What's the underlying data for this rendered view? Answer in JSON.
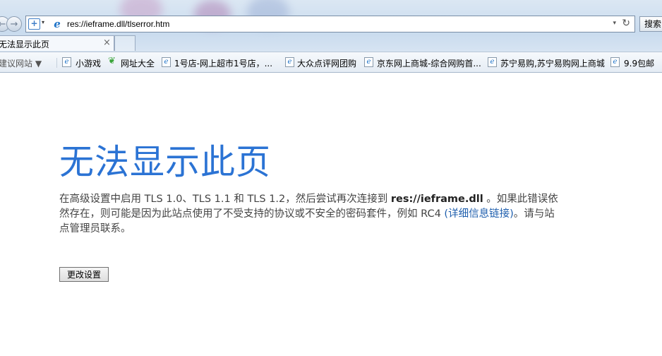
{
  "browser": {
    "address_url": "res://ieframe.dll/tlserror.htm",
    "search_label": "搜索",
    "tab_title": "无法显示此页",
    "tab_close": "×",
    "refresh_glyph": "↻",
    "chevron_glyph": "▾"
  },
  "favorites_bar": {
    "items": [
      {
        "label": "建议网站 ▼",
        "icon": "suggested-sites-icon"
      },
      {
        "label": "小游戏",
        "icon": "ie-page-icon"
      },
      {
        "label": "网址大全",
        "icon": "green-leaf-icon"
      },
      {
        "label": "1号店-网上超市1号店，...",
        "icon": "ie-page-icon"
      },
      {
        "label": "大众点评网团购",
        "icon": "ie-page-icon"
      },
      {
        "label": "京东网上商城-综合网购首...",
        "icon": "ie-page-icon"
      },
      {
        "label": "苏宁易购,苏宁易购网上商城",
        "icon": "ie-page-icon"
      },
      {
        "label": "9.9包邮",
        "icon": "ie-page-icon"
      }
    ]
  },
  "error_page": {
    "title": "无法显示此页",
    "body_part1": "在高级设置中启用 TLS 1.0、TLS 1.1 和 TLS 1.2，然后尝试再次连接到 ",
    "body_bold_url": "res://ieframe.dll",
    "body_part2": " 。如果此错误依然存在，则可能是因为此站点使用了不受支持的协议或不安全的密码套件，例如 RC4 ",
    "link_text": "(详细信息链接)",
    "body_part3": "。请与站点管理员联系。",
    "button_label": "更改设置"
  },
  "colors": {
    "title_blue": "#2b73d4",
    "link_blue": "#1f5fae",
    "body_text": "#444444"
  }
}
